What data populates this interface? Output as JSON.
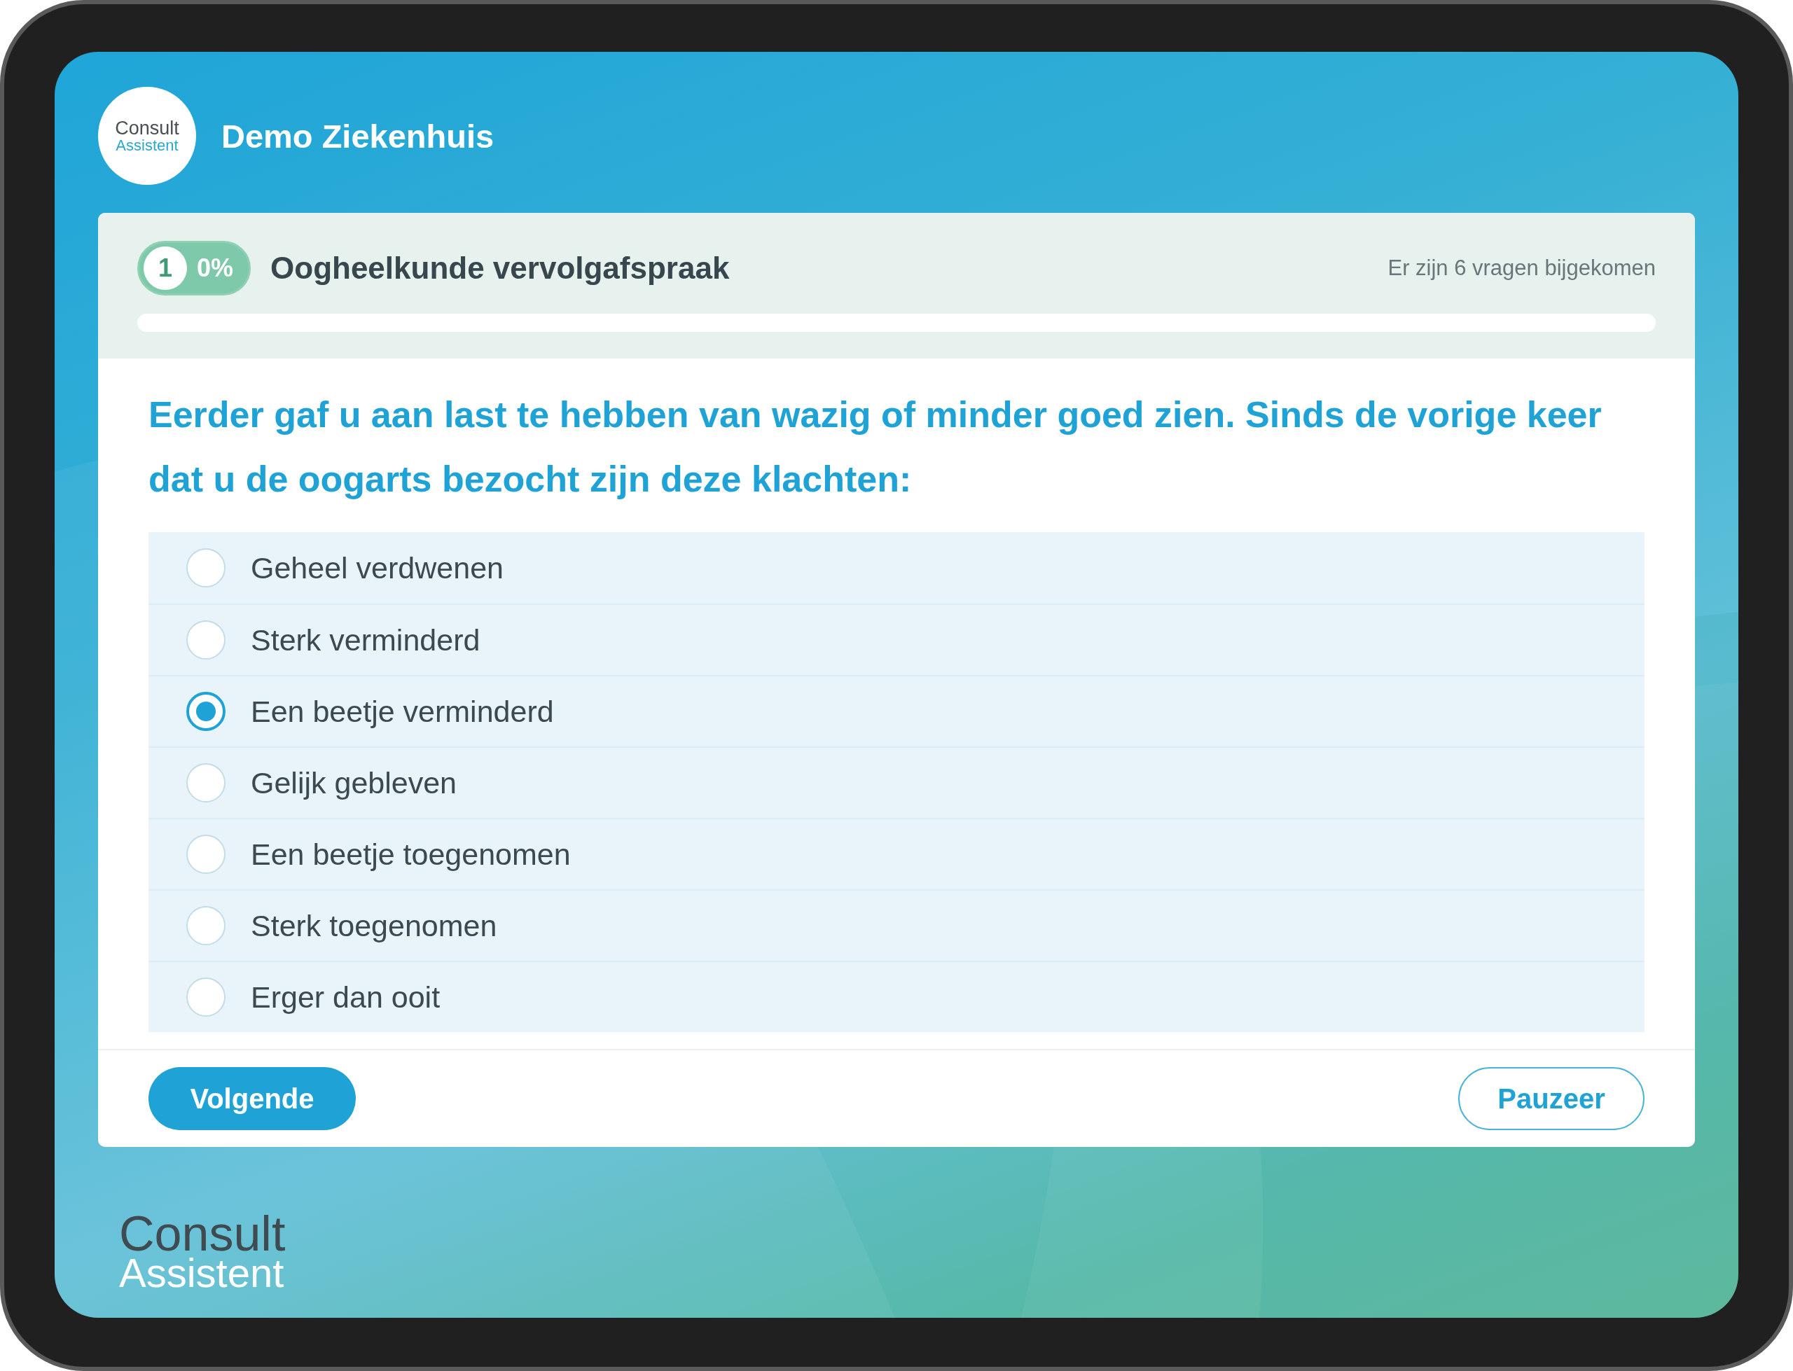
{
  "header": {
    "logo": {
      "line_1": "Consult",
      "line_2": "Assistent"
    },
    "title": "Demo Ziekenhuis"
  },
  "questionnaire": {
    "step": "1",
    "percent": "0%",
    "title": "Oogheelkunde vervolgafspraak",
    "notice": "Er zijn 6 vragen bijgekomen",
    "progress": {
      "level": 0
    }
  },
  "question": "Eerder gaf u aan last te hebben van wazig of minder goed zien. Sinds de vorige keer dat u de oogarts bezocht zijn deze klachten:",
  "options": [
    {
      "label": "Geheel verdwenen",
      "selected": false
    },
    {
      "label": "Sterk verminderd",
      "selected": false
    },
    {
      "label": "Een beetje verminderd",
      "selected": true
    },
    {
      "label": "Gelijk gebleven",
      "selected": false
    },
    {
      "label": "Een beetje toegenomen",
      "selected": false
    },
    {
      "label": "Sterk toegenomen",
      "selected": false
    },
    {
      "label": "Erger dan ooit",
      "selected": false
    }
  ],
  "buttons": {
    "next": "Volgende",
    "pause": "Pauzeer"
  },
  "footer_logo": {
    "line_1": "Consult",
    "line_2": "Assistent"
  }
}
